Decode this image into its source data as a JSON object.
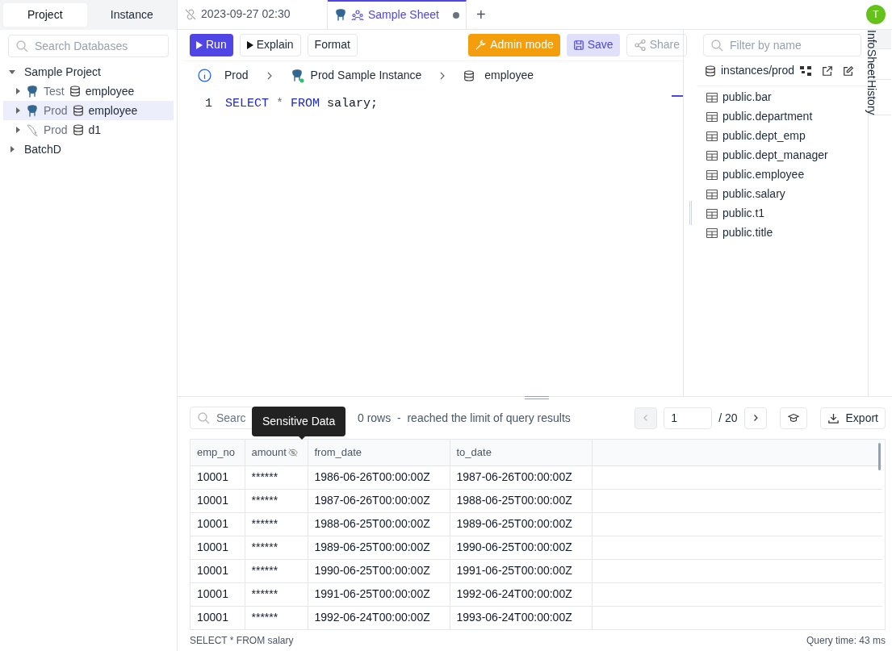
{
  "sidebar": {
    "tabs": [
      {
        "label": "Project",
        "selected": true
      },
      {
        "label": "Instance",
        "selected": false
      }
    ],
    "search": {
      "placeholder": "Search Databases"
    },
    "tree": [
      {
        "label": "Sample Project",
        "expanded": true,
        "children": [
          {
            "instance": "Test",
            "database": "employee",
            "kind": "postgres",
            "selected": false
          },
          {
            "instance": "Prod",
            "database": "employee",
            "kind": "postgres",
            "selected": true
          },
          {
            "instance": "Prod",
            "database": "d1",
            "kind": "mysql",
            "selected": false
          }
        ]
      },
      {
        "label": "BatchD",
        "expanded": false
      }
    ]
  },
  "tabs": [
    {
      "label": "2023-09-27 02:30",
      "kind": "unlinked",
      "selected": false,
      "unsaved": false
    },
    {
      "label": "Sample Sheet",
      "kind": "shared",
      "selected": true,
      "unsaved": true
    }
  ],
  "add_tab": "+",
  "avatar": {
    "initial": "T",
    "color": "#65c21b"
  },
  "toolbar": {
    "left": [
      "Run",
      "Explain",
      "Format"
    ],
    "admin": "Admin mode",
    "save": "Save",
    "share": "Share"
  },
  "breadcrumb": {
    "environment": "Prod",
    "instance": "Prod Sample Instance",
    "database": "employee"
  },
  "editor": {
    "lines": [
      {
        "number": "1",
        "tokens": [
          {
            "text": "SELECT",
            "kind": "keyword"
          },
          {
            "text": "*",
            "kind": "operator"
          },
          {
            "text": "FROM",
            "kind": "keyword"
          },
          {
            "text": "salary;",
            "kind": "plain"
          }
        ]
      }
    ]
  },
  "schema": {
    "filter_placeholder": "Filter by name",
    "path": "instances/prod",
    "tables": [
      "public.bar",
      "public.department",
      "public.dept_emp",
      "public.dept_manager",
      "public.employee",
      "public.salary",
      "public.t1",
      "public.title"
    ]
  },
  "side_tabs": [
    {
      "label": "Info",
      "selected": true
    },
    {
      "label": "Sheet",
      "selected": false
    },
    {
      "label": "History",
      "selected": false
    }
  ],
  "results": {
    "search_placeholder": "Searc",
    "summary": "0 rows  -  reached the limit of query results",
    "tooltip": "Sensitive Data",
    "page": "1",
    "total_pages": "/ 20",
    "export": "Export",
    "columns": [
      {
        "name": "emp_no",
        "sensitive": false
      },
      {
        "name": "amount",
        "sensitive": true
      },
      {
        "name": "from_date",
        "sensitive": false
      },
      {
        "name": "to_date",
        "sensitive": false
      }
    ],
    "rows": [
      [
        "10001",
        "******",
        "1986-06-26T00:00:00Z",
        "1987-06-26T00:00:00Z"
      ],
      [
        "10001",
        "******",
        "1987-06-26T00:00:00Z",
        "1988-06-25T00:00:00Z"
      ],
      [
        "10001",
        "******",
        "1988-06-25T00:00:00Z",
        "1989-06-25T00:00:00Z"
      ],
      [
        "10001",
        "******",
        "1989-06-25T00:00:00Z",
        "1990-06-25T00:00:00Z"
      ],
      [
        "10001",
        "******",
        "1990-06-25T00:00:00Z",
        "1991-06-25T00:00:00Z"
      ],
      [
        "10001",
        "******",
        "1991-06-25T00:00:00Z",
        "1992-06-24T00:00:00Z"
      ],
      [
        "10001",
        "******",
        "1992-06-24T00:00:00Z",
        "1993-06-24T00:00:00Z"
      ]
    ]
  },
  "status_bar": {
    "statement": "SELECT * FROM salary",
    "query_time": "Query time: 43 ms"
  }
}
